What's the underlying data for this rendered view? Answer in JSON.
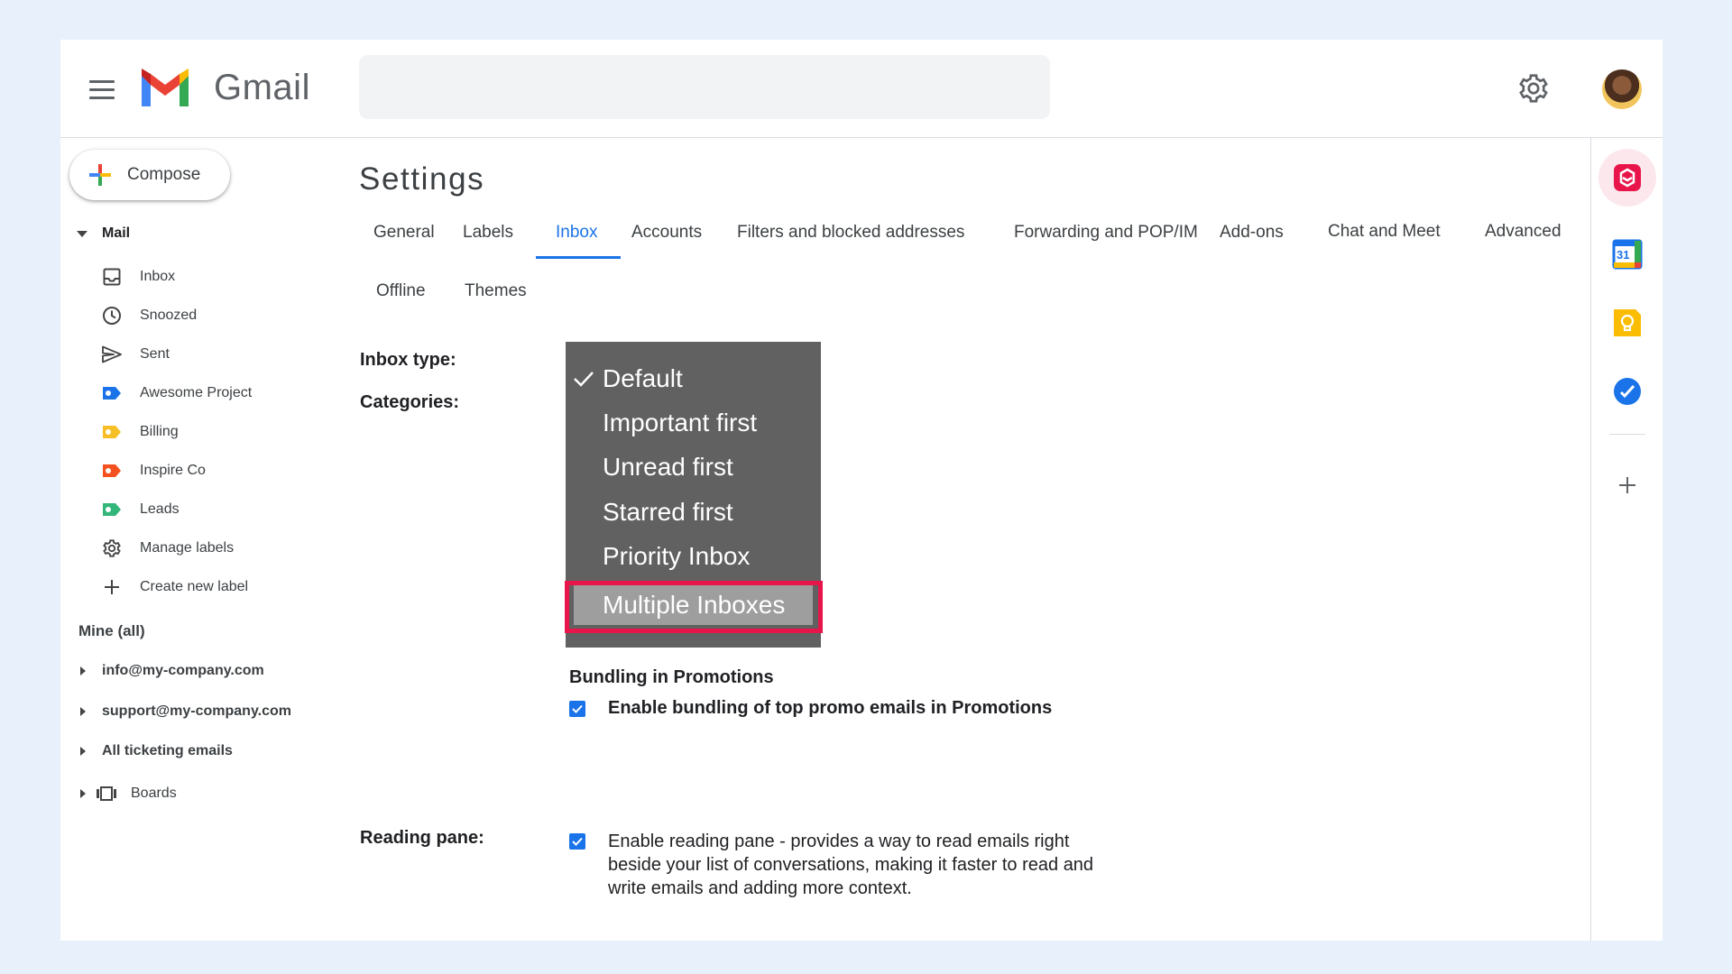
{
  "header": {
    "brand": "Gmail",
    "search_placeholder": ""
  },
  "sidebar": {
    "compose_label": "Compose",
    "mail_section": "Mail",
    "items": [
      {
        "label": "Inbox",
        "icon": "inbox-icon"
      },
      {
        "label": "Snoozed",
        "icon": "clock-icon"
      },
      {
        "label": "Sent",
        "icon": "send-icon"
      },
      {
        "label": "Awesome Project",
        "icon": "label-icon",
        "color": "#1a73e8"
      },
      {
        "label": "Billing",
        "icon": "label-icon",
        "color": "#f6bf26"
      },
      {
        "label": "Inspire Co",
        "icon": "label-icon",
        "color": "#f4511e"
      },
      {
        "label": "Leads",
        "icon": "label-icon",
        "color": "#33b679"
      },
      {
        "label": "Manage labels",
        "icon": "gear-icon"
      },
      {
        "label": "Create new label",
        "icon": "plus-icon"
      }
    ],
    "mine_section": "Mine (all)",
    "accounts": [
      "info@my-company.com",
      "support@my-company.com",
      "All ticketing emails"
    ],
    "boards_label": "Boards"
  },
  "settings": {
    "title": "Settings",
    "tabs": [
      "General",
      "Labels",
      "Inbox",
      "Accounts",
      "Filters and blocked addresses",
      "Forwarding and POP/IM",
      "Add-ons",
      "Chat and Meet",
      "Advanced",
      "Offline",
      "Themes"
    ],
    "active_tab": "Inbox",
    "inbox_type_label": "Inbox type:",
    "categories_label": "Categories:",
    "inbox_type_options": [
      "Default",
      "Important first",
      "Unread first",
      "Starred first",
      "Priority Inbox",
      "Multiple Inboxes"
    ],
    "selected_option": "Default",
    "highlighted_option": "Multiple Inboxes",
    "bundling_heading": "Bundling in Promotions",
    "bundling_checkbox": "Enable bundling of top promo emails in Promotions",
    "reading_pane_label": "Reading pane:",
    "reading_pane_lines": [
      "Enable reading pane - provides a way to read emails right",
      "beside your list of conversations, making it faster to read and",
      "write emails and adding more context."
    ]
  },
  "right_panel": {
    "calendar_day": "31"
  },
  "colors": {
    "accent": "#1a73e8",
    "highlight_border": "#e8154a",
    "dropdown_bg": "#616161"
  }
}
